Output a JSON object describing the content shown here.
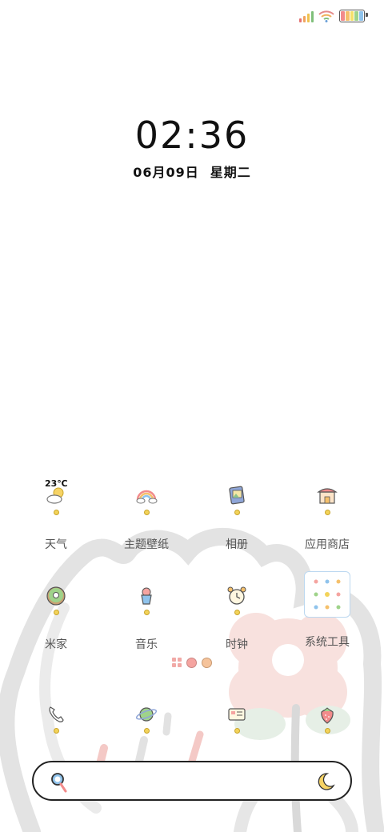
{
  "status_bar": {
    "icons": [
      "signal-icon",
      "wifi-icon",
      "battery-icon"
    ]
  },
  "lockscreen": {
    "time": "02:36",
    "date": "06月09日",
    "weekday": "星期二"
  },
  "weather": {
    "temperature": "23℃"
  },
  "apps": [
    {
      "label": "天气",
      "icon": "weather-icon"
    },
    {
      "label": "主题壁纸",
      "icon": "rainbow-icon"
    },
    {
      "label": "相册",
      "icon": "photo-album-icon"
    },
    {
      "label": "应用商店",
      "icon": "app-store-icon"
    },
    {
      "label": "米家",
      "icon": "donut-icon"
    },
    {
      "label": "音乐",
      "icon": "ice-cream-icon"
    },
    {
      "label": "时钟",
      "icon": "alarm-clock-icon"
    },
    {
      "label": "系统工具",
      "icon": "system-tools-folder-icon"
    }
  ],
  "dock": [
    {
      "icon": "phone-icon"
    },
    {
      "icon": "planet-icon"
    },
    {
      "icon": "message-card-icon"
    },
    {
      "icon": "strawberry-icon"
    }
  ],
  "search": {
    "left_icon": "search-lens-icon",
    "right_icon": "moon-icon"
  },
  "colors": {
    "accent": "#f5a4a0",
    "dot": "#f3d35a",
    "text": "#555555"
  }
}
